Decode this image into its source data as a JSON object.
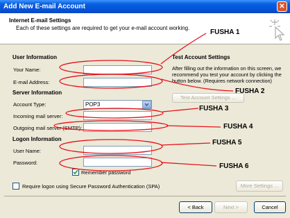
{
  "window": {
    "title": "Add New E-mail Account",
    "close_glyph": "✕"
  },
  "header": {
    "title": "Internet E-mail Settings",
    "subtitle": "Each of these settings are required to get your e-mail account working."
  },
  "user_info": {
    "section": "User Information",
    "name_label": "Your Name:",
    "name_value": "",
    "email_label": "E-mail Address:",
    "email_value": ""
  },
  "server_info": {
    "section": "Server Information",
    "account_type_label": "Account Type:",
    "account_type_value": "POP3",
    "incoming_label": "Incoming mail server:",
    "incoming_value": "",
    "outgoing_label": "Outgoing mail server (SMTP):",
    "outgoing_value": ""
  },
  "logon_info": {
    "section": "Logon Information",
    "username_label": "User Name:",
    "username_value": "",
    "password_label": "Password:",
    "password_value": "",
    "remember_label": "Remember password",
    "remember_checked": true
  },
  "spa": {
    "label": "Require logon using Secure Password Authentication (SPA)",
    "checked": false
  },
  "test": {
    "section": "Test Account Settings",
    "description": "After filling out the information on this screen, we recommend you test your account by clicking the button below. (Requires network connection)",
    "button": "Test Account Settings ..."
  },
  "buttons": {
    "more": "More Settings ...",
    "back": "< Back",
    "next": "Next >",
    "cancel": "Cancel"
  },
  "annotations": {
    "f1": "FUSHA 1",
    "f2": "FUSHA 2",
    "f3": "FUSHA 3",
    "f4": "FUSHA 4",
    "f5": "FUSHA 5",
    "f6": "FUSHA 6",
    "color": "#e8101a"
  },
  "icons": {
    "header_icon": "cursor-sparkle-icon",
    "dropdown": "chevron-down-icon"
  }
}
